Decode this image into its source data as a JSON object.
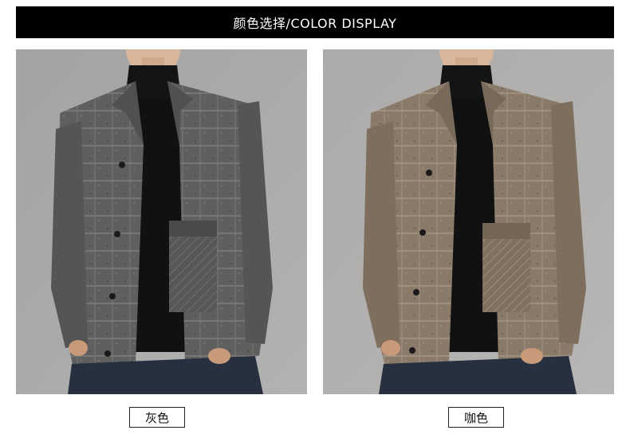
{
  "header": {
    "title": "颜色选择/COLOR DISPLAY"
  },
  "swatches": [
    {
      "label": "灰色",
      "jacket_color": "#5f5f5f",
      "jacket_dark": "#3f3f3f",
      "bg": "#a9a9a9"
    },
    {
      "label": "咖色",
      "jacket_color": "#8a7a69",
      "jacket_dark": "#6b5d4f",
      "bg": "#b1b0ae"
    }
  ],
  "colors": {
    "banner_bg": "#000000",
    "banner_text": "#ffffff"
  }
}
